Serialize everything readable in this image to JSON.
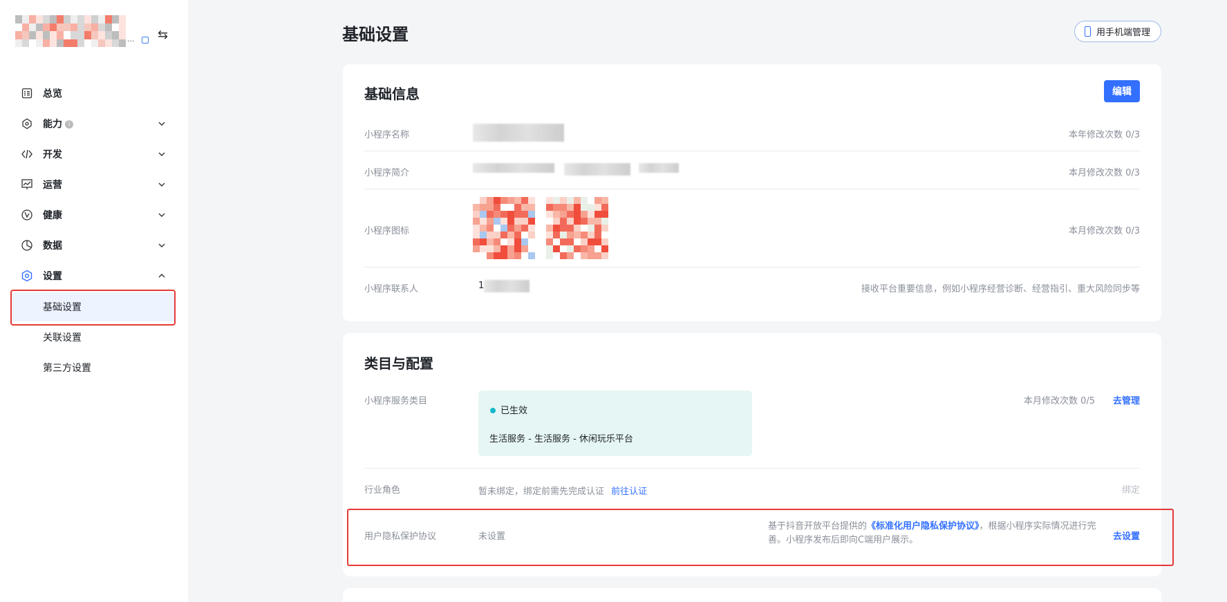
{
  "sidebar": {
    "nav": [
      {
        "label": "总览",
        "icon": "overview-icon"
      },
      {
        "label": "能力",
        "icon": "ability-icon",
        "info": "i"
      },
      {
        "label": "开发",
        "icon": "code-icon"
      },
      {
        "label": "运营",
        "icon": "operation-icon"
      },
      {
        "label": "健康",
        "icon": "health-icon"
      },
      {
        "label": "数据",
        "icon": "data-icon"
      },
      {
        "label": "设置",
        "icon": "settings-icon"
      }
    ],
    "sub_items": [
      "基础设置",
      "关联设置",
      "第三方设置"
    ],
    "active_sub": "基础设置",
    "brand_dots": "..."
  },
  "header": {
    "title": "基础设置",
    "mobile_button": "用手机端管理"
  },
  "basic_info": {
    "title": "基础信息",
    "edit_label": "编辑",
    "rows": [
      {
        "label": "小程序名称",
        "right": "本年修改次数 0/3"
      },
      {
        "label": "小程序简介",
        "right": "本月修改次数 0/3"
      },
      {
        "label": "小程序图标",
        "right": "本月修改次数 0/3"
      },
      {
        "label": "小程序联系人",
        "value_prefix": "1",
        "right": "接收平台重要信息，例如小程序经营诊断、经营指引、重大风险同步等"
      }
    ]
  },
  "category": {
    "title": "类目与配置",
    "service": {
      "label": "小程序服务类目",
      "status": "已生效",
      "category": "生活服务 - 生活服务 - 休闲玩乐平台",
      "count": "本月修改次数 0/5",
      "action": "去管理"
    },
    "role": {
      "label": "行业角色",
      "text": "暂未绑定，绑定前需先完成认证",
      "link": "前往认证",
      "action": "绑定"
    },
    "privacy": {
      "label": "用户隐私保护协议",
      "value": "未设置",
      "desc_prefix": "基于抖音开放平台提供的",
      "desc_link": "《标准化用户隐私保护协议》",
      "desc_suffix": "，根据小程序实际情况进行完善。小程序发布后即向C端用户展示。",
      "action": "去设置"
    }
  },
  "colors": {
    "accent": "#3370ff",
    "highlight": "#e53935",
    "status_bg": "#e6f6f4"
  }
}
